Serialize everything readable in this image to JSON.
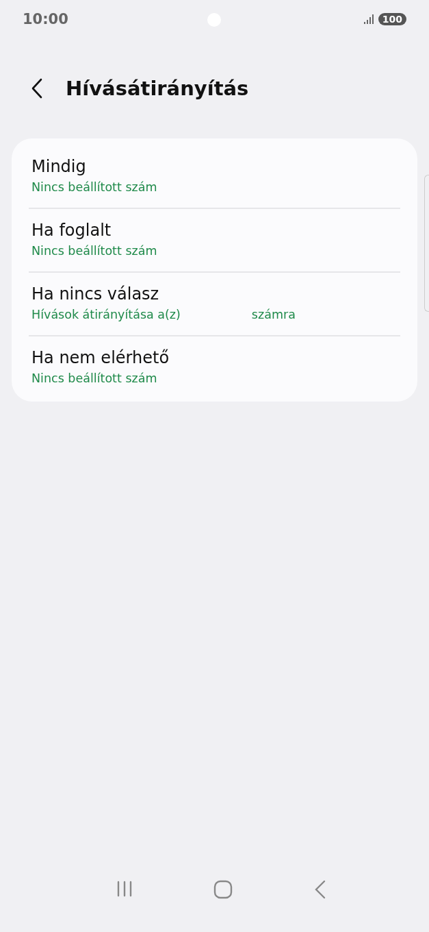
{
  "status_bar": {
    "time": "10:00",
    "battery": "100"
  },
  "header": {
    "title": "Hívásátirányítás"
  },
  "items": [
    {
      "title": "Mindig",
      "subtitle": "Nincs beállított szám"
    },
    {
      "title": "Ha foglalt",
      "subtitle": "Nincs beállított szám"
    },
    {
      "title": "Ha nincs válasz",
      "subtitle": "Hívások átirányítása a(z)",
      "subtitle_end": "számra"
    },
    {
      "title": "Ha nem elérhető",
      "subtitle": "Nincs beállított szám"
    }
  ]
}
